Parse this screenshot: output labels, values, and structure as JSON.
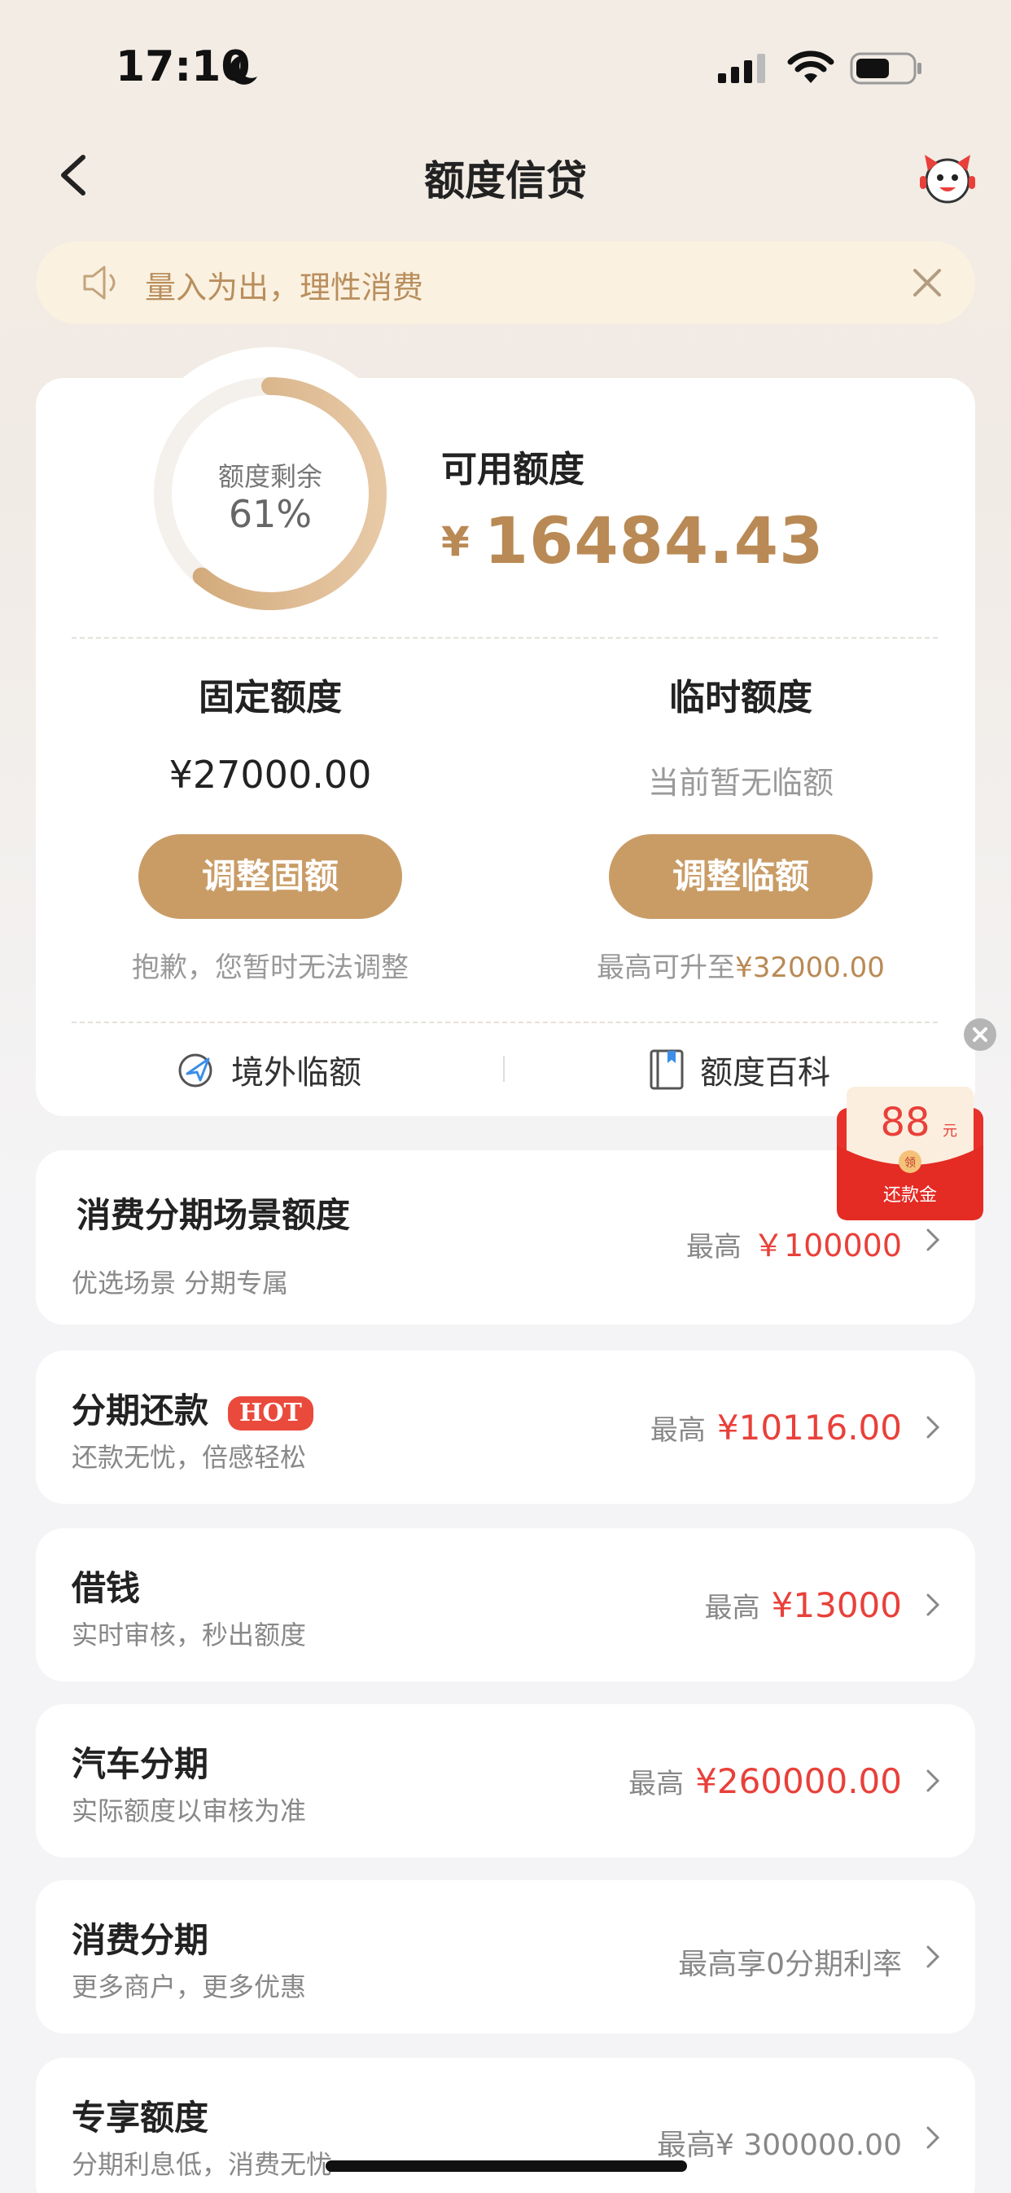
{
  "status_bar": {
    "time": "17:10"
  },
  "nav": {
    "title": "额度信贷"
  },
  "notice": {
    "text": "量入为出，理性消费"
  },
  "quota_card": {
    "ring_label": "额度剩余",
    "ring_percent": "61%",
    "ring_fraction": 0.61,
    "available_label": "可用额度",
    "available_currency": "¥",
    "available_amount": "16484.43",
    "fixed": {
      "label": "固定额度",
      "value": "¥27000.00",
      "button": "调整固额",
      "note": "抱歉，您暂时无法调整"
    },
    "temp": {
      "label": "临时额度",
      "value": "当前暂无临额",
      "button": "调整临额",
      "note_prefix": "最高可升至",
      "note_amount": "¥32000.00"
    },
    "links": {
      "overseas": "境外临额",
      "wiki": "额度百科"
    }
  },
  "promo": {
    "amount": "88",
    "unit": "元",
    "label": "还款金"
  },
  "rows": [
    {
      "title": "消费分期场景额度",
      "sub": "优选场景 分期专属",
      "prefix": "最高",
      "amount": "￥100000"
    },
    {
      "title": "分期还款",
      "badge": "HOT",
      "sub": "还款无忧，倍感轻松",
      "prefix": "最高",
      "amount": "¥10116.00"
    },
    {
      "title": "借钱",
      "sub": "实时审核，秒出额度",
      "prefix": "最高",
      "amount": "¥13000"
    },
    {
      "title": "汽车分期",
      "sub": "实际额度以审核为准",
      "prefix": "最高",
      "amount": "¥260000.00"
    },
    {
      "title": "消费分期",
      "sub": "更多商户，更多优惠",
      "right_text": "最高享0分期利率"
    },
    {
      "title": "专享额度",
      "sub": "分期利息低，消费无忧",
      "right_text": "最高¥ 300000.00"
    }
  ],
  "colors": {
    "accent": "#c99c66",
    "red": "#e9403a",
    "gold_text": "#b98a55"
  }
}
